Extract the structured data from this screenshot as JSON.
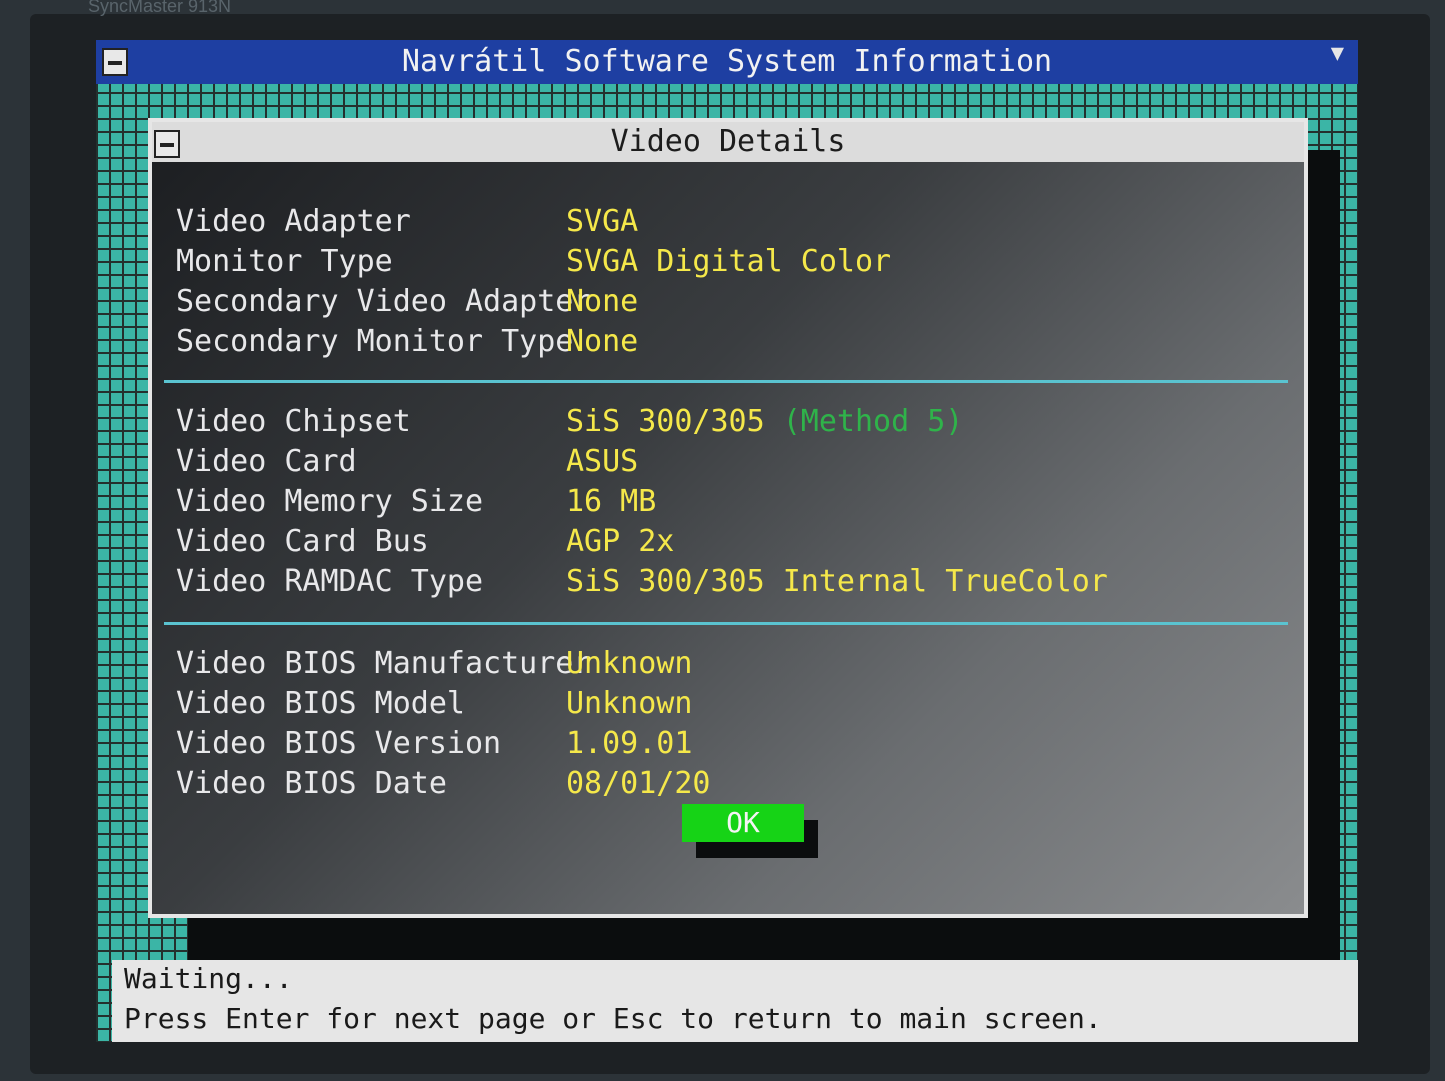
{
  "monitor": {
    "model_label": "SyncMaster 913N"
  },
  "window": {
    "title": "Navrátil Software System Information",
    "control_menu_icon": "dash-box",
    "scroll_icon": "triangle-down"
  },
  "dialog": {
    "title": "Video Details",
    "sections": [
      [
        {
          "label": "Video Adapter",
          "value": "SVGA"
        },
        {
          "label": "Monitor Type",
          "value": "SVGA Digital Color"
        },
        {
          "label": "Secondary Video Adapter",
          "value": "None"
        },
        {
          "label": "Secondary Monitor Type",
          "value": "None"
        }
      ],
      [
        {
          "label": "Video Chipset",
          "value": "SiS 300/305",
          "note": "(Method 5)"
        },
        {
          "label": "Video Card",
          "value": "ASUS"
        },
        {
          "label": "Video Memory Size",
          "value": "16 MB"
        },
        {
          "label": "Video Card Bus",
          "value": "AGP 2x"
        },
        {
          "label": "Video RAMDAC Type",
          "value": "SiS 300/305 Internal TrueColor"
        }
      ],
      [
        {
          "label": "Video BIOS Manufacturer",
          "value": "Unknown"
        },
        {
          "label": "Video BIOS Model",
          "value": "Unknown"
        },
        {
          "label": "Video BIOS Version",
          "value": "1.09.01"
        },
        {
          "label": "Video BIOS Date",
          "value": "08/01/20"
        }
      ]
    ],
    "ok_label": "OK"
  },
  "status": {
    "line1": "Waiting...",
    "line2": "Press Enter for next page or Esc to return to main screen."
  },
  "colors": {
    "title_bar": "#1e3fa2",
    "label_text": "#e8e8ea",
    "value_text": "#f5e84a",
    "note_text": "#2fb34a",
    "ok_button": "#16d316",
    "divider": "#5ac3d0"
  }
}
